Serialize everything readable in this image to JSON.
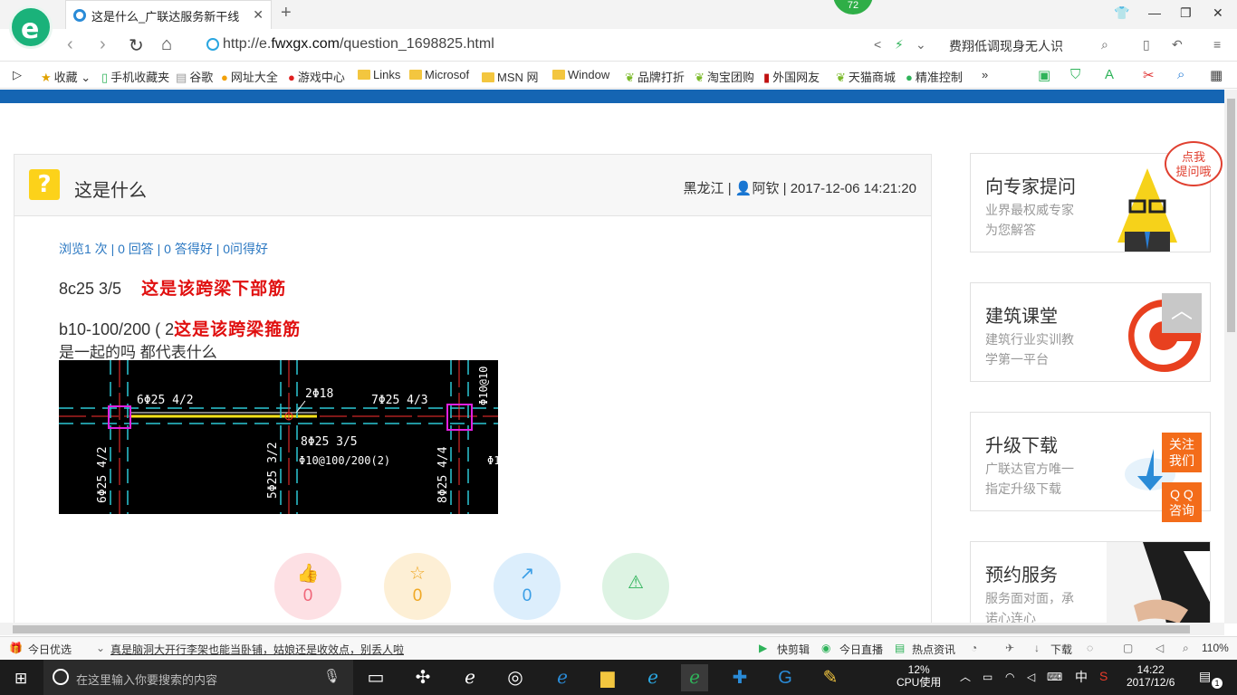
{
  "browser": {
    "logo_letter": "e",
    "tab_title": "这是什么_广联达服务新干线",
    "new_tab": "+",
    "badge": "72",
    "url_prefix": "http://e.",
    "url_domain": "fwxgx.com",
    "url_path": "/question_1698825.html",
    "search_text": "费翔低调现身无人识",
    "bookmarks": [
      "收藏",
      "手机收藏夹",
      "谷歌",
      "网址大全",
      "游戏中心",
      "Links",
      "Microsof",
      "MSN 网",
      "Window",
      "品牌打折",
      "淘宝团购",
      "外国网友",
      "天猫商城",
      "精准控制"
    ],
    "more": "»"
  },
  "question": {
    "title": "这是什么",
    "region": "黑龙江",
    "user": "阿钦",
    "time": "2017-12-06 14:21:20",
    "stats": "浏览1 次 | 0 回答 | 0 答得好 | 0问得好",
    "line1_text": "8c25 3/5",
    "line1_note": "这是该跨梁下部筋",
    "line2_text": "b10-100/200 ( 2",
    "line2_note": "这是该跨梁箍筋",
    "line3_text": "是一起的吗 都代表什么",
    "actions": [
      {
        "icon": "thumbs-up",
        "count": "0",
        "color": "#f0677a"
      },
      {
        "icon": "star",
        "count": "0",
        "color": "#f0a825"
      },
      {
        "icon": "share",
        "count": "0",
        "color": "#3a9ee6"
      },
      {
        "icon": "warning",
        "count": "",
        "color": "#2fb35a"
      }
    ]
  },
  "cad": {
    "labels": [
      "6Φ25 4/2",
      "2Φ18",
      "7Φ25 4/3",
      "Φ10@10",
      "8Φ25 3/5",
      "Φ10@100/200(2)",
      "6Φ25 4/2",
      "5Φ25 3/2",
      "8Φ25 4/4",
      "Φ1"
    ]
  },
  "sidebar": {
    "bubble": "点我\n提问哦",
    "cards": [
      {
        "title": "向专家提问",
        "sub1": "业界最权威专家",
        "sub2": "为您解答"
      },
      {
        "title": "建筑课堂",
        "sub1": "建筑行业实训教",
        "sub2": "学第一平台"
      },
      {
        "title": "升级下载",
        "sub1": "广联达官方唯一",
        "sub2": "指定升级下载"
      },
      {
        "title": "预约服务",
        "sub1": "服务面对面，承",
        "sub2": "诺心连心"
      }
    ],
    "follow": "关注\n我们",
    "qq": "Q Q\n咨询"
  },
  "statusbar": {
    "today": "今日优选",
    "headline": "真是脑洞大开行李架也能当卧铺，姑娘还是收效点，别丢人啦",
    "items": [
      "快剪辑",
      "今日直播",
      "热点资讯",
      "下载"
    ],
    "zoom": "110%"
  },
  "taskbar": {
    "search_placeholder": "在这里输入你要搜索的内容",
    "cpu": "12%",
    "cpu_label": "CPU使用",
    "ime": "中",
    "time": "14:22",
    "date": "2017/12/6",
    "notif": "1"
  }
}
